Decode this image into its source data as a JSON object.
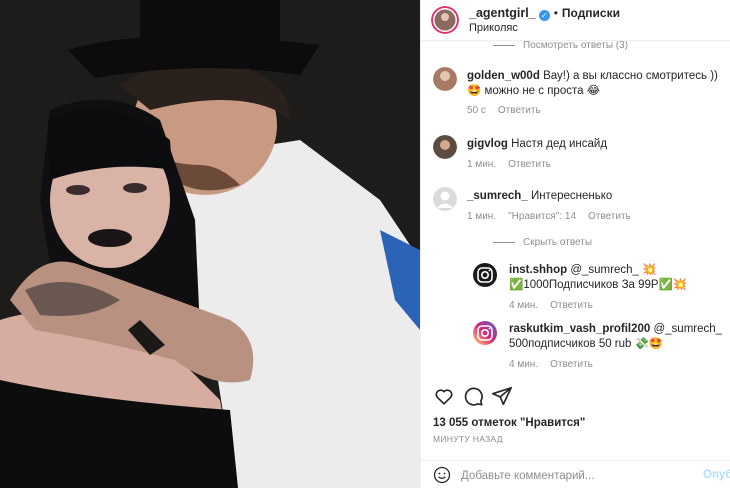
{
  "header": {
    "username": "_agentgirl_",
    "follow_label": "Подписки",
    "location": "Приколяс"
  },
  "comments": {
    "view_replies_label": "Посмотреть ответы (3)",
    "items": [
      {
        "user": "golden_w00d",
        "text": "Вау!) а вы классно смотритесь )) 🤩 можно не с проста 😂",
        "time": "50 с",
        "reply": "Ответить"
      },
      {
        "user": "gigvlog",
        "text": "Настя дед инсайд",
        "time": "1 мин.",
        "reply": "Ответить"
      },
      {
        "user": "_sumrech_",
        "text": "Интересненько",
        "time": "1 мин.",
        "likes": "\"Нравится\": 14",
        "reply": "Ответить"
      }
    ],
    "hide_replies_label": "Скрыть ответы",
    "replies": [
      {
        "user": "inst.shhop",
        "text": "@_sumrech_ 💥✅1000Подписчиков За 99Р✅💥",
        "time": "4 мин.",
        "reply": "Ответить"
      },
      {
        "user": "raskutkim_vash_profil200",
        "text": "@_sumrech_ 500подписчиков 50 rub 💸🤩",
        "time": "4 мин.",
        "reply": "Ответить"
      }
    ]
  },
  "actions": {
    "like_icon": "heart-icon",
    "comment_icon": "comment-icon",
    "share_icon": "share-icon"
  },
  "likes_label": "13 055 отметок \"Нравится\"",
  "time_label": "МИНУТУ НАЗАД",
  "add_comment": {
    "placeholder": "Добавьте комментарий...",
    "publish_label": "Опубликовать"
  }
}
